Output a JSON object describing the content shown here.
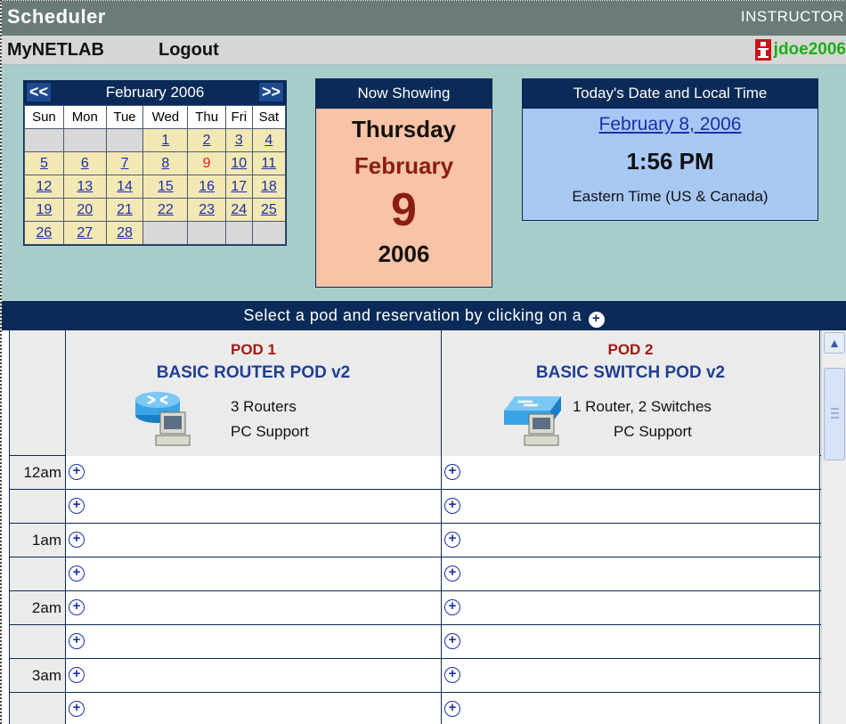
{
  "header": {
    "title": "Scheduler",
    "role": "INSTRUCTOR",
    "nav": {
      "mynetlab": "MyNETLAB",
      "logout": "Logout"
    },
    "username": "jdoe2006"
  },
  "calendar": {
    "prev": "<<",
    "next": ">>",
    "month_label": "February 2006",
    "weekdays": [
      "Sun",
      "Mon",
      "Tue",
      "Wed",
      "Thu",
      "Fri",
      "Sat"
    ],
    "weeks": [
      [
        "",
        "",
        "",
        "1",
        "2",
        "3",
        "4"
      ],
      [
        "5",
        "6",
        "7",
        "8",
        "9",
        "10",
        "11"
      ],
      [
        "12",
        "13",
        "14",
        "15",
        "16",
        "17",
        "18"
      ],
      [
        "19",
        "20",
        "21",
        "22",
        "23",
        "24",
        "25"
      ],
      [
        "26",
        "27",
        "28",
        "",
        "",
        "",
        ""
      ]
    ],
    "selected_day": "9"
  },
  "now_showing": {
    "title": "Now Showing",
    "weekday": "Thursday",
    "month": "February",
    "day": "9",
    "year": "2006"
  },
  "today": {
    "title": "Today's Date and Local Time",
    "date": "February 8, 2006",
    "time": "1:56 PM",
    "zone": "Eastern Time (US & Canada)"
  },
  "instructions": "Select a pod and reservation by clicking on a",
  "pods": [
    {
      "num": "POD 1",
      "name": "BASIC ROUTER POD v2",
      "desc1": "3 Routers",
      "desc2": "PC Support",
      "icon": "router-pc-icon"
    },
    {
      "num": "POD 2",
      "name": "BASIC SWITCH POD v2",
      "desc1": "1 Router, 2 Switches",
      "desc2": "PC Support",
      "icon": "switch-pc-icon"
    }
  ],
  "time_rows": [
    "12am",
    "",
    "1am",
    "",
    "2am",
    "",
    "3am",
    ""
  ],
  "colors": {
    "header_bg": "#6b7b7a",
    "navy": "#0a2b57",
    "teal": "#a7cdcb",
    "calendar_bg": "#f1e8b4",
    "now_showing_bg": "#f9c3a7",
    "today_bg": "#a8c8f4",
    "pod_num_red": "#9e1a14",
    "pod_name_blue": "#1f3f93",
    "username_green": "#19b019"
  }
}
